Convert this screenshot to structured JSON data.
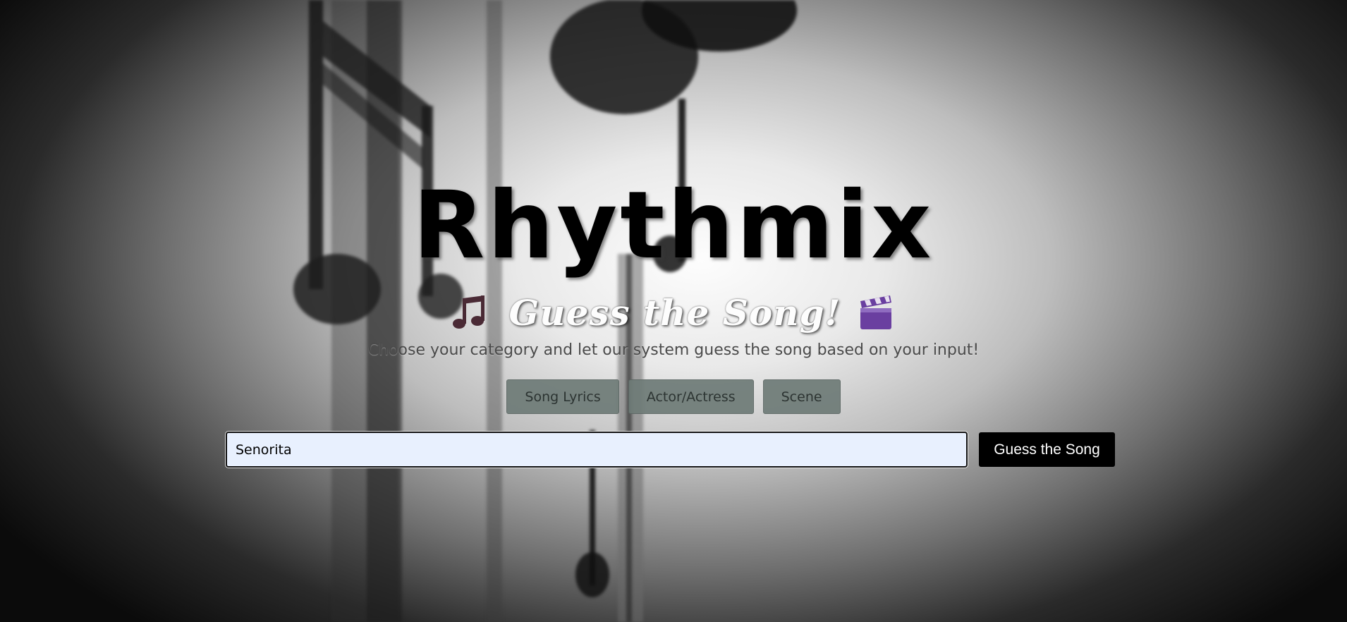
{
  "app": {
    "title": "Rhythmix",
    "subtitle": "Guess the Song!",
    "tagline": "Choose your category and let our system guess the song based on your input!"
  },
  "categories": [
    {
      "label": "Song Lyrics"
    },
    {
      "label": "Actor/Actress"
    },
    {
      "label": "Scene"
    }
  ],
  "search": {
    "value": "Senorita",
    "placeholder": ""
  },
  "actions": {
    "guess_label": "Guess the Song"
  },
  "icons": {
    "left": "musical-notes-icon",
    "right": "clapperboard-icon"
  },
  "colors": {
    "category_button_bg": "#6e7b77",
    "guess_button_bg": "#000000",
    "input_bg": "#e8f0fe",
    "clapper_purple": "#6a3fa0",
    "notes_color": "#4a2a35"
  }
}
